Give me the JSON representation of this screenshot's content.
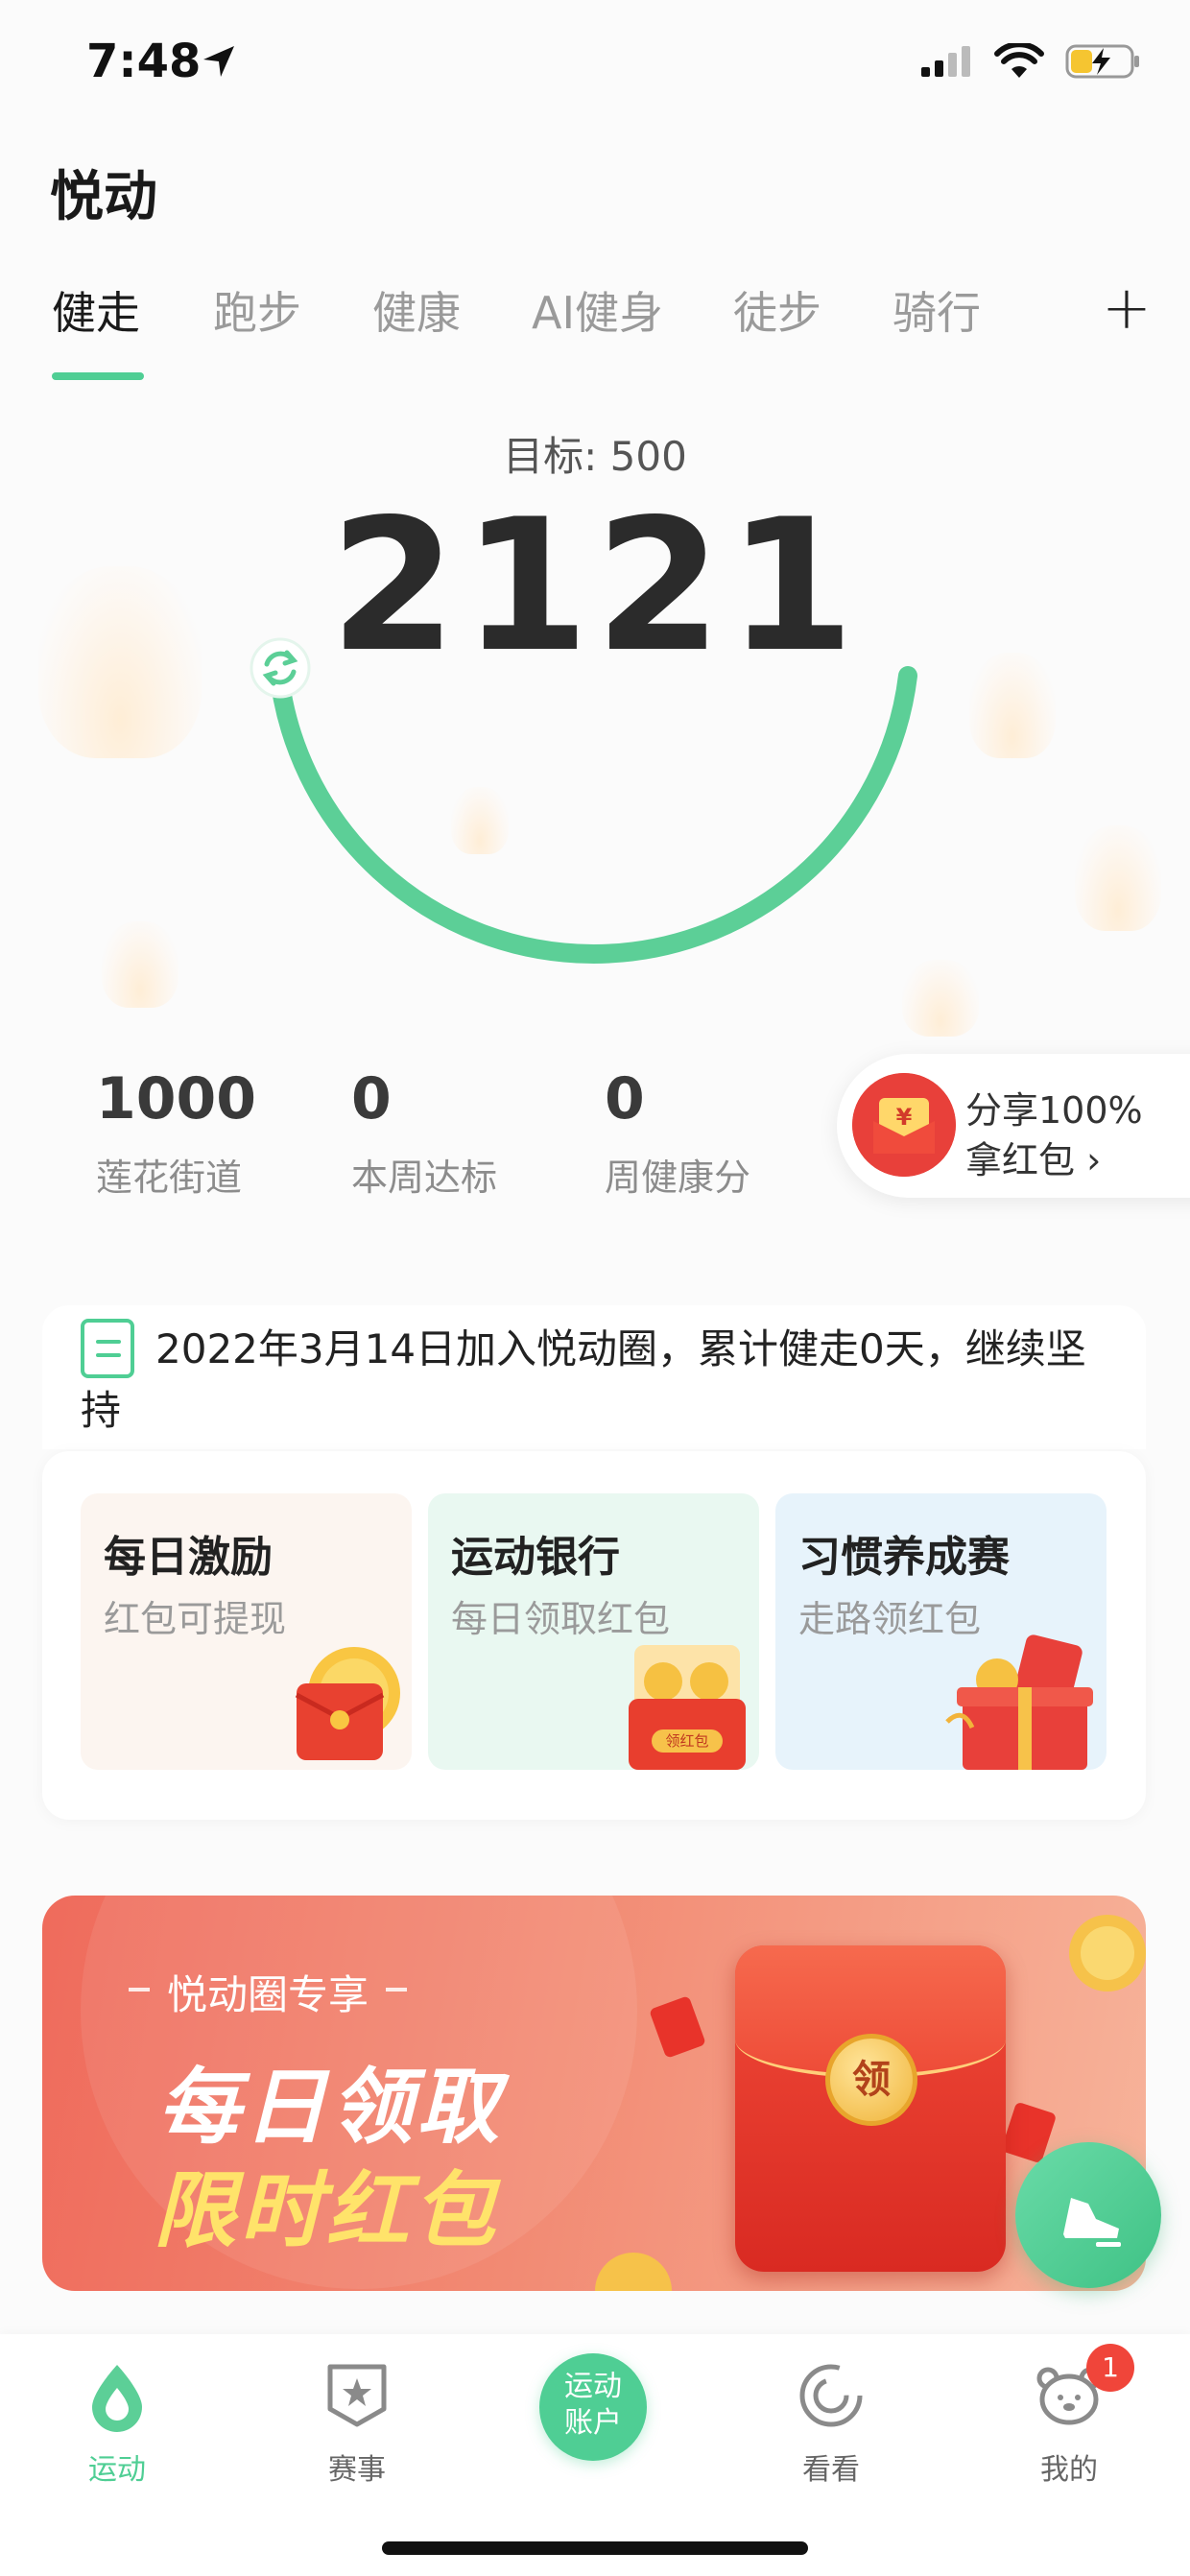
{
  "status_bar": {
    "time": "7:48",
    "icons": [
      "location-arrow-icon",
      "cellular-icon",
      "wifi-icon",
      "battery-charging-icon"
    ]
  },
  "header": {
    "title": "悦动"
  },
  "tabs": [
    {
      "label": "健走",
      "active": true
    },
    {
      "label": "跑步"
    },
    {
      "label": "健康"
    },
    {
      "label": "AI健身"
    },
    {
      "label": "徒步"
    },
    {
      "label": "骑行"
    }
  ],
  "tab_add_label": "+",
  "hero": {
    "goal_label": "目标: 500",
    "steps": "2121",
    "accent_color": "#4fce94"
  },
  "stats": [
    {
      "value": "1000",
      "label": "莲花街道"
    },
    {
      "value": "0",
      "label": "本周达标"
    },
    {
      "value": "0",
      "label": "周健康分"
    }
  ],
  "share": {
    "line1": "分享100%",
    "line2": "拿红包 ›"
  },
  "notice": {
    "text": "2022年3月14日加入悦动圈，累计健走0天，继续坚持"
  },
  "cards": [
    {
      "title": "每日激励",
      "subtitle": "红包可提现",
      "bg": "#fcf5f0"
    },
    {
      "title": "运动银行",
      "subtitle": "每日领取红包",
      "bg": "#e9f8f1"
    },
    {
      "title": "习惯养成赛",
      "subtitle": "走路领红包",
      "bg": "#e7f3fb"
    }
  ],
  "card2_envelope_label": "领红包",
  "banner": {
    "tag": "悦动圈专享",
    "line1": "每日领取",
    "line2": "限时红包",
    "seal": "领"
  },
  "bottom_nav": {
    "items": [
      {
        "label": "运动",
        "active": true
      },
      {
        "label": "赛事"
      },
      {
        "label": "看看"
      },
      {
        "label": "我的"
      }
    ],
    "center_line1": "运动",
    "center_line2": "账户",
    "badge": "1"
  }
}
